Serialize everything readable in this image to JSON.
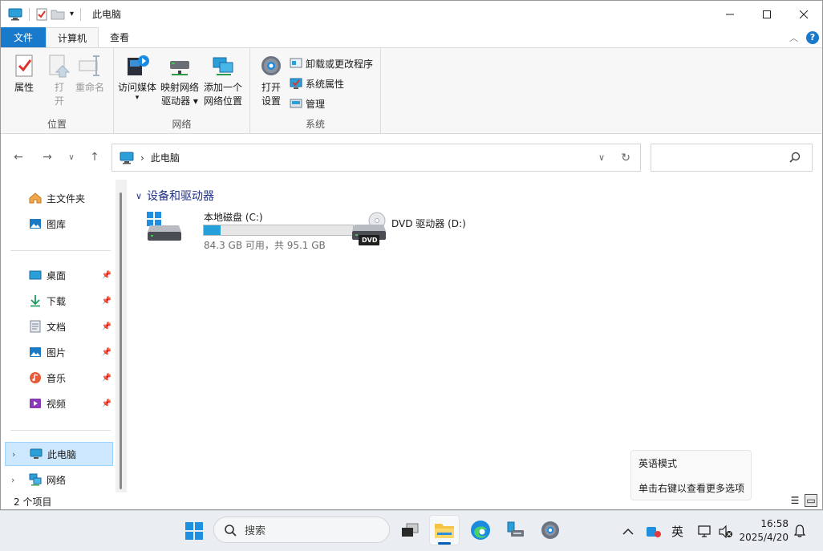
{
  "window": {
    "title": "此电脑"
  },
  "tabs": {
    "file": "文件",
    "computer": "计算机",
    "view": "查看"
  },
  "ribbon": {
    "location": {
      "label": "位置",
      "properties": "属性",
      "open_l1": "打",
      "open_l2": "开",
      "rename": "重命名"
    },
    "network": {
      "label": "网络",
      "media_l1": "访问媒体",
      "map_l1": "映射网络",
      "map_l2": "驱动器",
      "add_l1": "添加一个",
      "add_l2": "网络位置"
    },
    "system": {
      "label": "系统",
      "settings_l1": "打开",
      "settings_l2": "设置",
      "uninstall": "卸载或更改程序",
      "sysprops": "系统属性",
      "manage": "管理"
    }
  },
  "address": {
    "path": "此电脑"
  },
  "nav": {
    "home": "主文件夹",
    "gallery": "图库",
    "desktop": "桌面",
    "downloads": "下载",
    "documents": "文档",
    "pictures": "图片",
    "music": "音乐",
    "videos": "视频",
    "thispc": "此电脑",
    "network": "网络"
  },
  "content": {
    "section": "设备和驱动器",
    "drives": [
      {
        "name": "本地磁盘 (C:)",
        "free": "84.3 GB 可用，共 95.1 GB",
        "used_fraction": 0.114
      },
      {
        "name": "DVD 驱动器 (D:)",
        "badge": "DVD"
      }
    ]
  },
  "status": {
    "count": "2 个项目"
  },
  "ime_tip": {
    "line1": "英语模式",
    "line2": "单击右键以查看更多选项"
  },
  "taskbar": {
    "search": "搜索",
    "ime": "英",
    "time": "16:58",
    "date": "2025/4/20"
  },
  "colors": {
    "accent": "#1979ca",
    "selection": "#cde8ff",
    "bar_fill": "#26a0da",
    "section_heading": "#1e3287"
  }
}
